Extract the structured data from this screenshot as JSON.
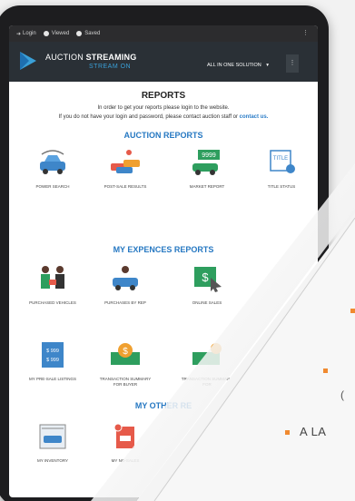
{
  "topbar": {
    "login": "Login",
    "viewed": "Viewed",
    "saved": "Saved",
    "more": "⋮"
  },
  "header": {
    "brand_main": "AUCTION",
    "brand_bold": "STREAMING",
    "brand_sub": "STREAM ON",
    "solution": "ALL IN ONE SOLUTION",
    "solution_caret": "▾",
    "menu": "⋮"
  },
  "page": {
    "title": "REPORTS",
    "intro_line1": "In order to get your reports please login to the website.",
    "intro_line2": "If you do not have your login and password, please contact auction staff or",
    "contact_link": "contact us."
  },
  "sections": {
    "auction": {
      "title": "AUCTION REPORTS",
      "items": [
        "POWER SEARCH",
        "POST-SALE RESULTS",
        "MARKET REPORT",
        "TITLE STATUS"
      ]
    },
    "expences": {
      "title": "MY EXPENCES REPORTS",
      "items": [
        "PURCHASED VEHICLES",
        "PURCHASES BY REP",
        "ONLINE SALES",
        "MY PRE-SALE LISTINGS",
        "TRANSACTION SUMMARY FOR BUYER",
        "TRANSACTION SUMMARY FOR"
      ]
    },
    "other": {
      "title": "MY OTHER RE",
      "items": [
        "MY INVENTORY",
        "MY NO-SALES"
      ]
    }
  },
  "icon_text": {
    "price1": "$ 999",
    "price2": "$ 999",
    "market_screen": "9999",
    "title_doc": "TITLE",
    "dollar": "$"
  },
  "overlay_text": {
    "tagline": "A LA",
    "partial": "("
  },
  "colors": {
    "accent_blue": "#2678c2",
    "header_bg": "#2a3036",
    "brand_blue": "#3aa0d8",
    "bullet_orange": "#f08a30",
    "green": "#2e9e5e"
  }
}
